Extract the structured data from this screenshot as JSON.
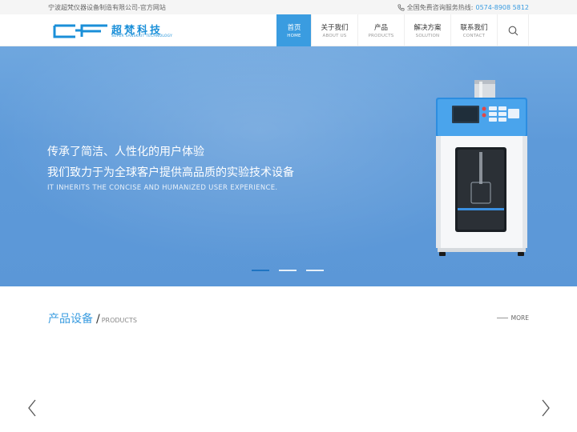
{
  "topbar": {
    "company": "宁波超梵仪器设备制造有限公司-官方网站",
    "hotline_label": "全国免费咨询服务热线:",
    "hotline_number": "0574-8908 5812",
    "icon": "phone-icon"
  },
  "header": {
    "logo_text": "超梵科技",
    "logo_sub": "SUPER SANSKRIT TECHNOLOGY",
    "brand_color": "#1a8fd8"
  },
  "nav": {
    "items": [
      {
        "cn": "首页",
        "en": "HOME"
      },
      {
        "cn": "关于我们",
        "en": "ABOUT US"
      },
      {
        "cn": "产品",
        "en": "PRODUCTS"
      },
      {
        "cn": "解决方案",
        "en": "SOLUTION"
      },
      {
        "cn": "联系我们",
        "en": "CONTACT"
      }
    ],
    "active_index": 0,
    "search_icon": "search-icon",
    "accent_color": "#3a9ce0"
  },
  "banner": {
    "line1": "传承了简洁、人性化的用户体验",
    "line2": "我们致力于为全球客户提供高品质的实验技术设备",
    "line_en": "IT INHERITS THE CONCISE AND HUMANIZED USER EXPERIENCE.",
    "slides": 3,
    "active_slide": 0
  },
  "products": {
    "title_cn": "产品设备",
    "slash": "/",
    "title_en": "PRODUCTS",
    "more": "MORE",
    "prev_icon": "chevron-left-icon",
    "next_icon": "chevron-right-icon"
  }
}
